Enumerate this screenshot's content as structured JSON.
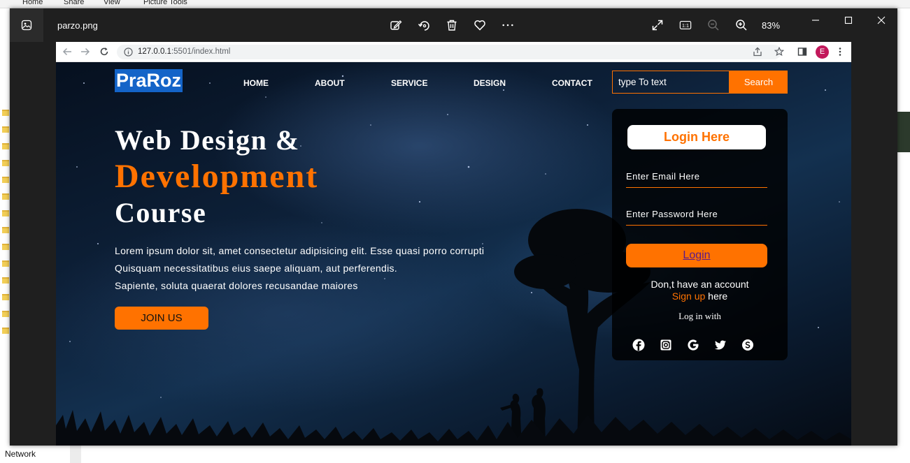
{
  "explorer": {
    "tabs": [
      "Home",
      "Share",
      "View",
      "Picture Tools"
    ],
    "status_network": "Network"
  },
  "viewer": {
    "file_name": "parzo.png",
    "zoom": "83%",
    "icons": [
      "edit-icon",
      "rotate-icon",
      "delete-icon",
      "favorite-icon",
      "more-icon",
      "fullscreen-icon",
      "actual-size-icon",
      "zoom-out-icon",
      "zoom-in-icon"
    ]
  },
  "browser": {
    "url_host": "127.0.0.1",
    "url_rest": ":5501/index.html",
    "avatar_letter": "E"
  },
  "page": {
    "logo": "PraRoz",
    "nav": [
      "HOME",
      "ABOUT",
      "SERVICE",
      "DESIGN",
      "CONTACT"
    ],
    "search": {
      "value": "type To text",
      "button": "Search"
    },
    "hero": {
      "line1": "Web Design &",
      "line2": "Development",
      "line3": "Course",
      "para": [
        "Lorem ipsum dolor sit, amet consectetur adipisicing elit. Esse quasi porro corrupti",
        "Quisquam necessitatibus eius saepe aliquam, aut perferendis.",
        "Sapiente, soluta quaerat dolores recusandae maiores"
      ],
      "join": "JOIN US"
    },
    "login": {
      "title": "Login Here",
      "email": "Enter Email Here",
      "password": "Enter Password Here",
      "button": "Login",
      "no_account": "Don,t have an account",
      "signup_link": "Sign up",
      "signup_rest": " here",
      "log_in_with": "Log in with",
      "socials": [
        "facebook-icon",
        "instagram-icon",
        "google-icon",
        "twitter-icon",
        "skype-icon"
      ]
    }
  },
  "colors": {
    "accent": "#ff7200",
    "logo_bg": "#1464c8",
    "viewer_bg": "#1f1f1f"
  }
}
